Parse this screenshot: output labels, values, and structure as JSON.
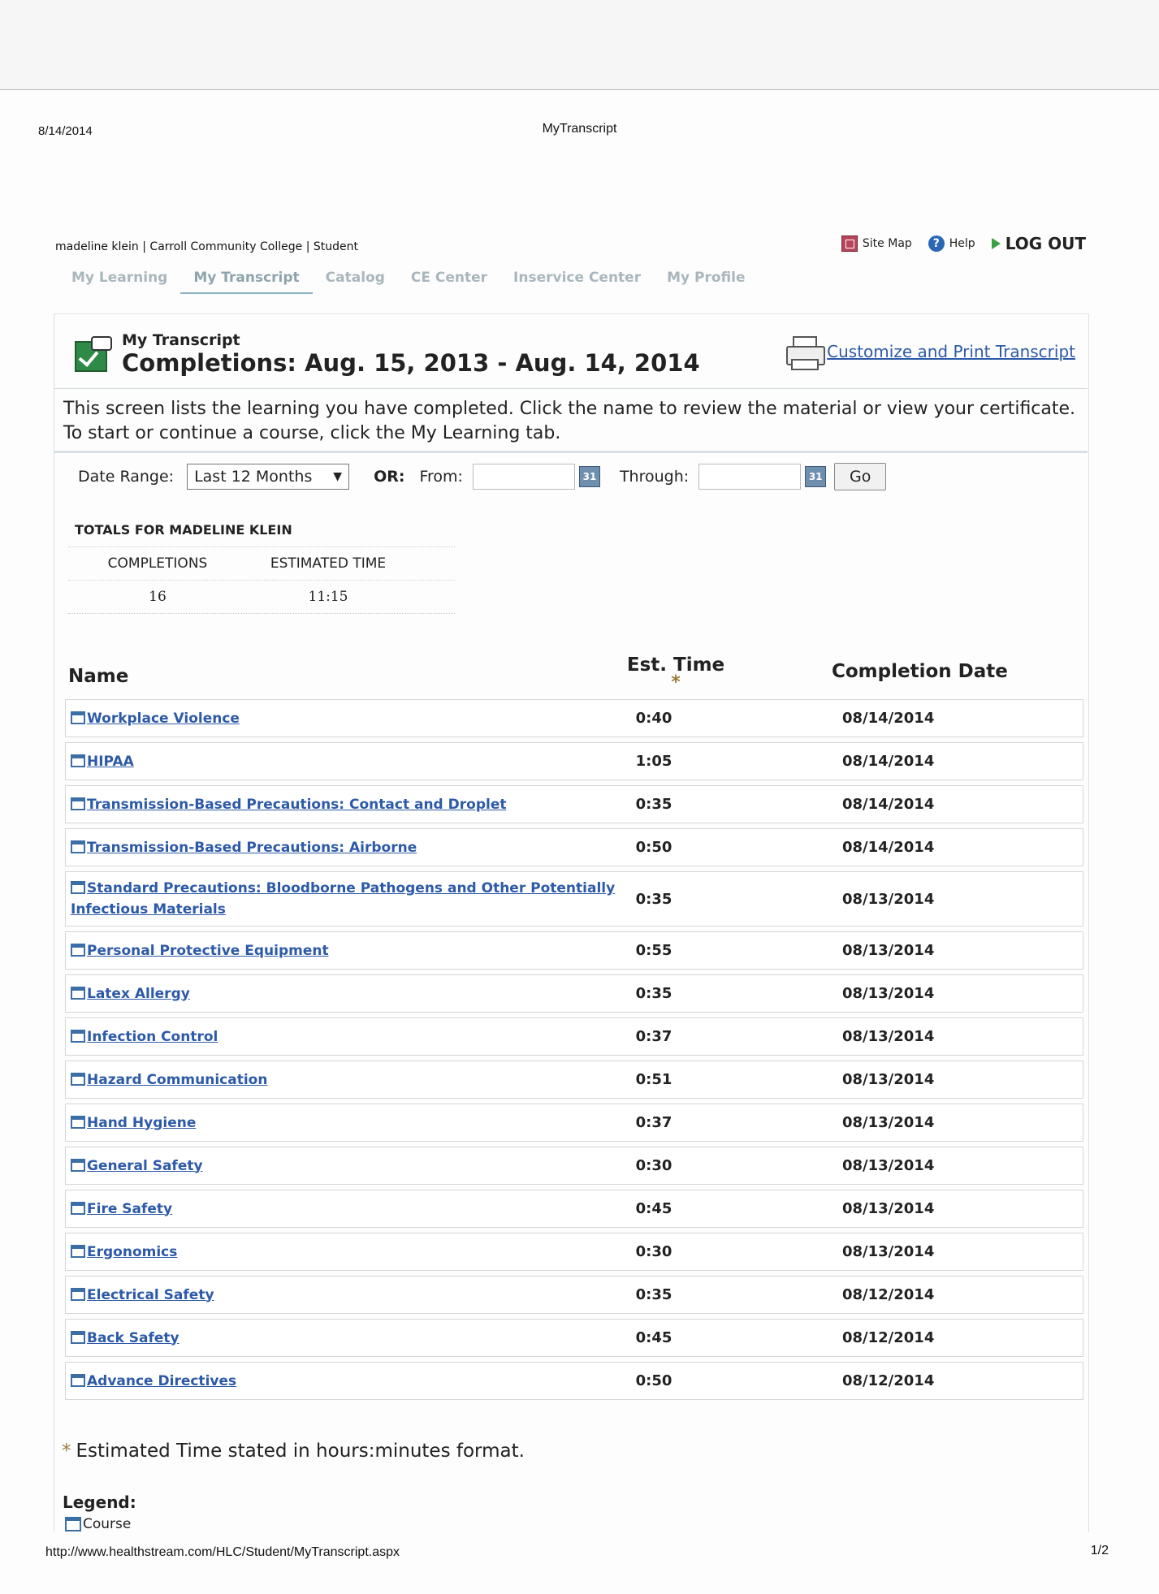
{
  "print_header": {
    "date": "8/14/2014",
    "title": "MyTranscript"
  },
  "user_line": "madeline klein | Carroll Community College | Student",
  "top_links": {
    "site_map": "Site Map",
    "help": "Help",
    "logout": "LOG OUT"
  },
  "tabs": [
    {
      "label": "My Learning",
      "active": false
    },
    {
      "label": "My Transcript",
      "active": true
    },
    {
      "label": "Catalog",
      "active": false
    },
    {
      "label": "CE Center",
      "active": false
    },
    {
      "label": "Inservice Center",
      "active": false
    },
    {
      "label": "My Profile",
      "active": false
    }
  ],
  "header": {
    "title": "My Transcript",
    "range": "Completions: Aug. 15, 2013 - Aug. 14, 2014",
    "print_link": "Customize and Print Transcript"
  },
  "intro": "This screen lists the learning you have completed. Click the name to review the material or view your certificate. To start or continue a course, click the My Learning tab.",
  "filter": {
    "date_range_label": "Date Range:",
    "date_range_value": "Last 12 Months",
    "or_label": "OR:",
    "from_label": "From:",
    "from_value": "",
    "calendar_icon": "31",
    "through_label": "Through:",
    "through_value": "",
    "go_label": "Go"
  },
  "totals": {
    "title": "TOTALS FOR MADELINE KLEIN",
    "completions_label": "COMPLETIONS",
    "time_label": "ESTIMATED TIME",
    "completions_value": "16",
    "time_value": "11:15"
  },
  "columns": {
    "name": "Name",
    "time": "Est. Time",
    "date": "Completion Date"
  },
  "courses": [
    {
      "name": "Workplace Violence",
      "time": "0:40",
      "date": "08/14/2014"
    },
    {
      "name": "HIPAA",
      "time": "1:05",
      "date": "08/14/2014"
    },
    {
      "name": "Transmission-Based Precautions: Contact and Droplet",
      "time": "0:35",
      "date": "08/14/2014"
    },
    {
      "name": "Transmission-Based Precautions: Airborne",
      "time": "0:50",
      "date": "08/14/2014"
    },
    {
      "name": "Standard Precautions: Bloodborne Pathogens and Other Potentially Infectious Materials",
      "time": "0:35",
      "date": "08/13/2014"
    },
    {
      "name": "Personal Protective Equipment",
      "time": "0:55",
      "date": "08/13/2014"
    },
    {
      "name": "Latex Allergy",
      "time": "0:35",
      "date": "08/13/2014"
    },
    {
      "name": "Infection Control",
      "time": "0:37",
      "date": "08/13/2014"
    },
    {
      "name": "Hazard Communication",
      "time": "0:51",
      "date": "08/13/2014"
    },
    {
      "name": "Hand Hygiene",
      "time": "0:37",
      "date": "08/13/2014"
    },
    {
      "name": "General Safety",
      "time": "0:30",
      "date": "08/13/2014"
    },
    {
      "name": "Fire Safety",
      "time": "0:45",
      "date": "08/13/2014"
    },
    {
      "name": "Ergonomics",
      "time": "0:30",
      "date": "08/13/2014"
    },
    {
      "name": "Electrical Safety",
      "time": "0:35",
      "date": "08/12/2014"
    },
    {
      "name": "Back Safety",
      "time": "0:45",
      "date": "08/12/2014"
    },
    {
      "name": "Advance Directives",
      "time": "0:50",
      "date": "08/12/2014"
    }
  ],
  "footnote": "Estimated Time stated in hours:minutes format.",
  "legend": {
    "title": "Legend:",
    "course": "Course"
  },
  "print_footer": {
    "url": "http://www.healthstream.com/HLC/Student/MyTranscript.aspx",
    "page": "1/2"
  },
  "colors": {
    "link": "#2d5aa8",
    "tab_inactive": "#a9b7bd",
    "logout_arrow": "#3aa043",
    "calendar": "#6f8fae"
  }
}
